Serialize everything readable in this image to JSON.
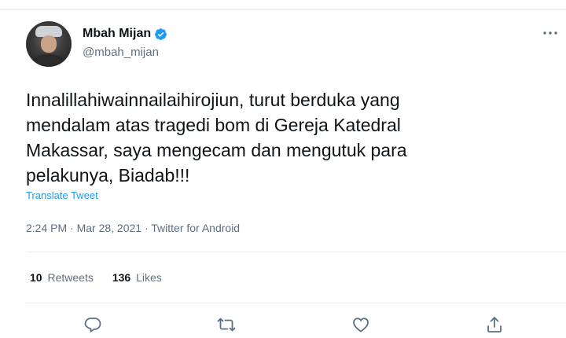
{
  "tweet": {
    "author": {
      "display_name": "Mbah Mijan",
      "handle": "@mbah_mijan",
      "verified": true
    },
    "text": "Innalillahiwainnailaihirojiun, turut berduka yang\nmendalam atas tragedi bom di Gereja Katedral\nMakassar, saya mengecam dan mengutuk para\npelakunya, Biadab!!!",
    "translate_label": "Translate Tweet",
    "meta": "2:24 PM · Mar 28, 2021 · Twitter for Android",
    "stats": {
      "retweets_count": "10",
      "retweets_label": "Retweets",
      "likes_count": "136",
      "likes_label": "Likes"
    }
  },
  "colors": {
    "accent": "#1d9bf0",
    "text_primary": "#0f1419",
    "text_secondary": "#5b7083",
    "divider": "#e6ecf0"
  },
  "icons": [
    "verified-badge-icon",
    "more-icon",
    "reply-icon",
    "retweet-icon",
    "like-icon",
    "share-icon"
  ]
}
